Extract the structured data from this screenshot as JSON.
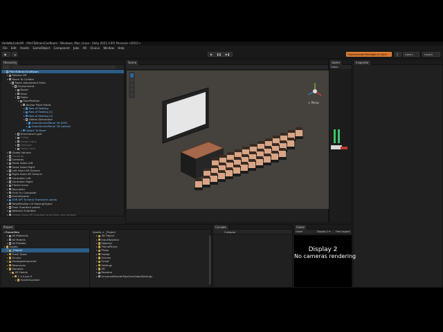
{
  "window": {
    "title": "HelloNoCodeXR - PitchToBrainCineRoom - Windows, Mac, Linux - Unity 2021.3.9f1 Personal <DX11>"
  },
  "menu": [
    "File",
    "Edit",
    "Assets",
    "GameObject",
    "Component",
    "Jobs",
    "XR",
    "Oculus",
    "Window",
    "Help"
  ],
  "toolbar": {
    "experimental_label": "Experimental Packages In Use ▾",
    "layers_label": "Layers",
    "layout_label": "Layout"
  },
  "hierarchy": {
    "tab_label": "Hierarchy",
    "rows": [
      {
        "label": "PitchToBrainCineRoom",
        "indent": 1,
        "sel": true,
        "dim": false,
        "blue": false
      },
      {
        "label": "Session XR",
        "indent": 2,
        "sel": false,
        "dim": false,
        "blue": false
      },
      {
        "label": "Room To Callibre",
        "indent": 2,
        "sel": false,
        "dim": false,
        "blue": false
      },
      {
        "label": "Room Adjustment Point",
        "indent": 3,
        "sel": false,
        "dim": false,
        "blue": false
      },
      {
        "label": "Environment",
        "indent": 4,
        "sel": false,
        "dim": false,
        "blue": false
      },
      {
        "label": "Board",
        "indent": 5,
        "sel": false,
        "dim": false,
        "blue": false
      },
      {
        "label": "Desk",
        "indent": 5,
        "sel": false,
        "dim": false,
        "blue": false
      },
      {
        "label": "Public",
        "indent": 5,
        "sel": false,
        "dim": false,
        "blue": false
      },
      {
        "label": "SavePosition",
        "indent": 6,
        "sel": false,
        "dim": false,
        "blue": false
      },
      {
        "label": "Anchor Point Public",
        "indent": 7,
        "sel": false,
        "dim": false,
        "blue": false
      },
      {
        "label": "Row of Seating",
        "indent": 8,
        "sel": false,
        "dim": false,
        "blue": true
      },
      {
        "label": "Row of Seating (1)",
        "indent": 8,
        "sel": false,
        "dim": false,
        "blue": true
      },
      {
        "label": "Row of Seating (2)",
        "indent": 8,
        "sel": false,
        "dim": false,
        "blue": true
      },
      {
        "label": "Videos Distraction",
        "indent": 8,
        "sel": false,
        "dim": false,
        "blue": false
      },
      {
        "label": "GreenScreenPanel 3D JOYD",
        "indent": 9,
        "sel": false,
        "dim": false,
        "blue": true
      },
      {
        "label": "GreenScreenPanel 3D Lakeref",
        "indent": 9,
        "sel": false,
        "dim": false,
        "blue": true
      },
      {
        "label": "Object To Move",
        "indent": 7,
        "sel": false,
        "dim": false,
        "blue": true
      },
      {
        "label": "Directional Light",
        "indent": 5,
        "sel": false,
        "dim": false,
        "blue": false
      },
      {
        "label": "Fullsal",
        "indent": 5,
        "sel": false,
        "dim": true,
        "blue": false
      },
      {
        "label": "Empty Light",
        "indent": 5,
        "sel": false,
        "dim": true,
        "blue": false
      },
      {
        "label": "Exemple",
        "indent": 5,
        "sel": false,
        "dim": true,
        "blue": false
      },
      {
        "label": "Video Cube",
        "indent": 5,
        "sel": false,
        "dim": true,
        "blue": false
      },
      {
        "label": "Global Volume",
        "indent": 2,
        "sel": false,
        "dim": false,
        "blue": false
      },
      {
        "label": "Cameras",
        "indent": 2,
        "sel": false,
        "dim": true,
        "blue": false
      },
      {
        "label": "Cameras",
        "indent": 2,
        "sel": false,
        "dim": false,
        "blue": false
      },
      {
        "label": "Hand Index Left",
        "indent": 2,
        "sel": false,
        "dim": false,
        "blue": false
      },
      {
        "label": "Hand Index Right",
        "indent": 2,
        "sel": false,
        "dim": false,
        "blue": false
      },
      {
        "label": "Left Hand XR Generic",
        "indent": 2,
        "sel": false,
        "dim": false,
        "blue": false
      },
      {
        "label": "Right Hand XR Generic",
        "indent": 2,
        "sel": false,
        "dim": false,
        "blue": false
      },
      {
        "label": "Controller Left",
        "indent": 2,
        "sel": false,
        "dim": false,
        "blue": false
      },
      {
        "label": "Controller Right",
        "indent": 2,
        "sel": false,
        "dim": false,
        "blue": false
      },
      {
        "label": "Fleche Icons",
        "indent": 2,
        "sel": false,
        "dim": false,
        "blue": false
      },
      {
        "label": "Raycaster",
        "indent": 2,
        "sel": false,
        "dim": false,
        "blue": false
      },
      {
        "label": "Only On Computer",
        "indent": 2,
        "sel": false,
        "dim": false,
        "blue": false
      },
      {
        "label": "EventSystem",
        "indent": 2,
        "sel": false,
        "dim": false,
        "blue": false
      },
      {
        "label": "OVR API To Hand Transform points",
        "indent": 2,
        "sel": false,
        "dim": false,
        "blue": true
      },
      {
        "label": "ResetPosition Of MovingObject",
        "indent": 2,
        "sel": false,
        "dim": false,
        "blue": false
      },
      {
        "label": "Push Guardian points",
        "indent": 2,
        "sel": false,
        "dim": false,
        "blue": false
      },
      {
        "label": "Abstract Guardian",
        "indent": 2,
        "sel": false,
        "dim": false,
        "blue": false
      },
      {
        "label": "Create Gaze XR Guardian and Enter non-random",
        "indent": 2,
        "sel": false,
        "dim": true,
        "blue": false
      }
    ]
  },
  "scene": {
    "tab_label": "Scene",
    "persp_label": "< Persp"
  },
  "game_top": {
    "tab_label": "Game",
    "sub_label": "Game"
  },
  "inspector": {
    "tab_label": "Inspector"
  },
  "project": {
    "tab_label": "Project",
    "breadcrumb": "Assets > _Project",
    "favorites_label": "Favorites",
    "favorites": [
      "All Materials",
      "All Models",
      "All Prefabs"
    ],
    "tree": [
      {
        "label": "Assets",
        "indent": 1,
        "sel": false
      },
      {
        "label": "_Project",
        "indent": 2,
        "sel": true
      },
      {
        "label": "Fresh Store",
        "indent": 2,
        "sel": false
      },
      {
        "label": "Oculus",
        "indent": 2,
        "sel": false
      },
      {
        "label": "PackagesImported",
        "indent": 2,
        "sel": false
      },
      {
        "label": "Resources",
        "indent": 2,
        "sel": false
      },
      {
        "label": "Samples",
        "indent": 2,
        "sel": false
      },
      {
        "label": "XR Hands",
        "indent": 3,
        "sel": false
      },
      {
        "label": "1.1.0-pre.3",
        "indent": 4,
        "sel": false
      },
      {
        "label": "HandVisualizer",
        "indent": 5,
        "sel": false
      }
    ],
    "items": [
      "3D Object",
      "InputToAction",
      "Material",
      "PitchaPitche",
      "Photo",
      "Prefab",
      "Scenes",
      "Script",
      "Settings",
      "XR",
      "Readme",
      "UniversalRenderPipelineGlobalSettings"
    ]
  },
  "console": {
    "tab_label": "Console",
    "collapse_label": "Collapse"
  },
  "game": {
    "tab_label": "Game",
    "game_label": "Game",
    "display_label": "Display 2 ▾",
    "aspect_label": "Free Aspect",
    "display_text": "Display 2",
    "no_camera_text": "No cameras rendering"
  },
  "colors": {
    "accent_orange": "#d6742a",
    "selection_blue": "#2c5d87",
    "prefab_blue": "#7cc0ff",
    "scene_background": "#45413c"
  }
}
